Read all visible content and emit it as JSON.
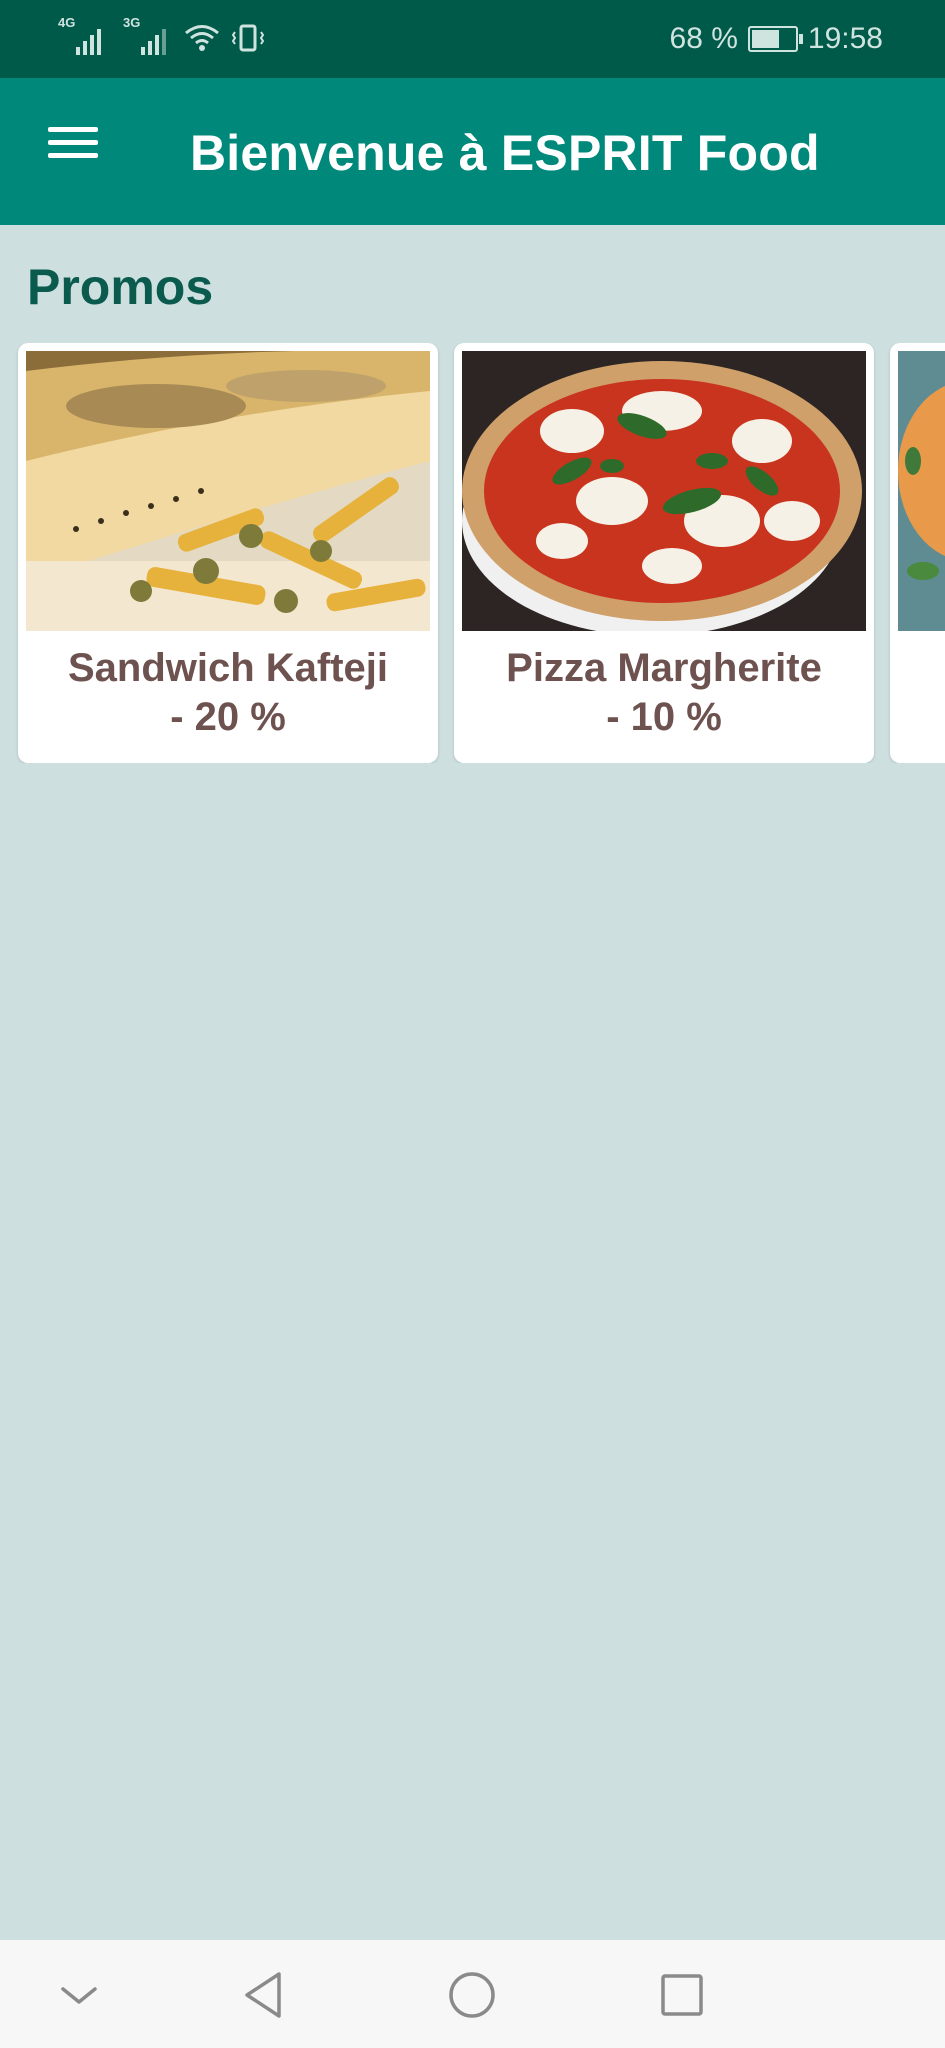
{
  "status_bar": {
    "network_1": "4G",
    "network_2": "3G",
    "battery_percent": "68 %",
    "battery_level": 0.68,
    "time": "19:58"
  },
  "app_bar": {
    "title": "Bienvenue à ESPRIT Food",
    "menu_icon": "hamburger-menu-icon",
    "background": "#00897a"
  },
  "promos": {
    "title": "Promos",
    "items": [
      {
        "name": "Sandwich Kafteji",
        "discount": "- 20 %",
        "image": "sandwich-photo"
      },
      {
        "name": "Pizza Margherite",
        "discount": "- 10 %",
        "image": "pizza-photo"
      },
      {
        "name": "",
        "discount": "",
        "image": "melon-photo"
      }
    ]
  },
  "nav_bar": {
    "icons": [
      "chevron-down-icon",
      "back-triangle-icon",
      "home-circle-icon",
      "recents-square-icon"
    ]
  },
  "colors": {
    "status_bar": "#005a4a",
    "background": "#cddfdf",
    "section_title": "#0b5a4e",
    "card_text": "#6d5250"
  }
}
